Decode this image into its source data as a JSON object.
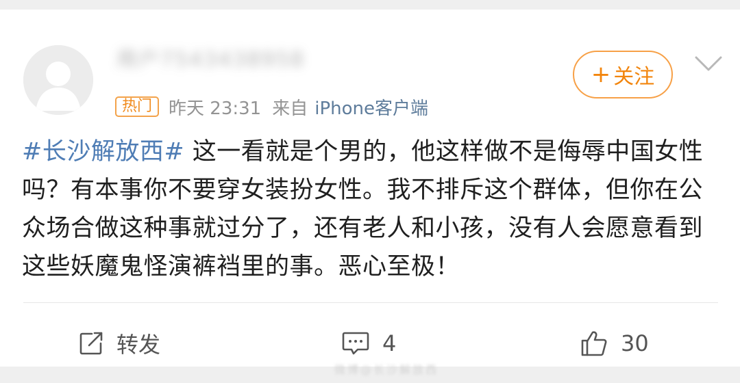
{
  "user": {
    "name": "用户7543438958",
    "avatar_icon": "default-avatar-icon"
  },
  "meta": {
    "badge": "热门",
    "time": "昨天 23:31",
    "source_prefix": "来自",
    "source": "iPhone客户端"
  },
  "follow_button": {
    "plus": "+",
    "label": "关注"
  },
  "post": {
    "hashtag": "#长沙解放西#",
    "body": " 这一看就是个男的，他这样做不是侮辱中国女性吗？有本事你不要穿女装扮女性。我不排斥这个群体，但你在公众场合做这种事就过分了，还有老人和小孩，没有人会愿意看到这些妖魔鬼怪演裤裆里的事。恶心至极！"
  },
  "actions": {
    "repost_label": "转发",
    "comment_count": "4",
    "like_count": "30"
  },
  "watermark": "微博@长沙解放西",
  "colors": {
    "accent_orange": "#f2850d",
    "link_blue": "#4f7db5",
    "text": "#1f1f1f",
    "meta_gray": "#939393"
  }
}
